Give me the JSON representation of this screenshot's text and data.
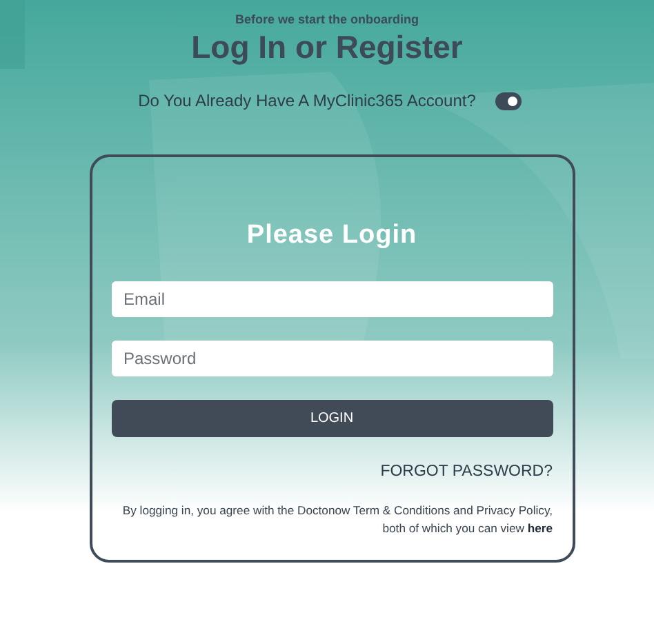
{
  "header": {
    "subtitle": "Before we start the onboarding",
    "title": "Log In or Register"
  },
  "account_toggle": {
    "label": "Do You Already Have A MyClinic365 Account?",
    "on": true
  },
  "login_card": {
    "title": "Please Login",
    "fields": [
      {
        "placeholder": "Email"
      },
      {
        "placeholder": "Password"
      }
    ],
    "button": "LOGIN",
    "forgot_link": "FORGOT PASSWORD?",
    "terms": {
      "text": "By logging in, you agree with the Doctonow Term & Conditions and Privacy Policy, both of which you can view",
      "link": "here"
    }
  }
}
